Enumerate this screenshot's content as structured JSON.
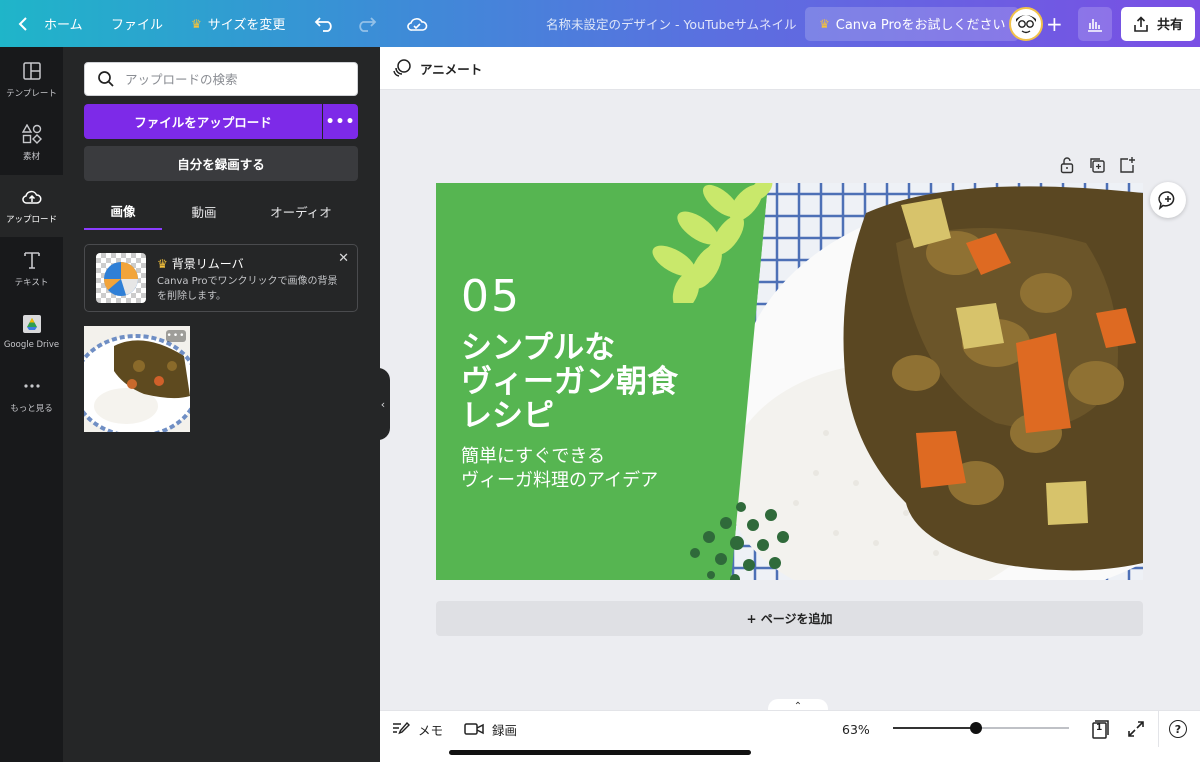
{
  "topbar": {
    "home_label": "ホーム",
    "file_label": "ファイル",
    "resize_label": "サイズを変更",
    "doc_title": "名称未設定のデザイン - YouTubeサムネイル",
    "pro_label": "Canva Proをお試しください",
    "share_label": "共有"
  },
  "rail": {
    "items": [
      {
        "label": "テンプレート",
        "icon": "layout-icon"
      },
      {
        "label": "素材",
        "icon": "shapes-icon"
      },
      {
        "label": "アップロード",
        "icon": "cloud-upload-icon"
      },
      {
        "label": "テキスト",
        "icon": "text-icon"
      },
      {
        "label": "Google Drive",
        "icon": "google-drive-icon"
      },
      {
        "label": "もっと見る",
        "icon": "more-icon"
      }
    ]
  },
  "panel": {
    "search_placeholder": "アップロードの検索",
    "upload_button": "ファイルをアップロード",
    "more_label": "•••",
    "record_button": "自分を録画する",
    "tabs": [
      "画像",
      "動画",
      "オーディオ"
    ],
    "promo": {
      "title": "背景リムーバ",
      "desc": "Canva Proでワンクリックで画像の背景を削除します。",
      "close": "✕"
    },
    "thumb_dots": "•••"
  },
  "canvas": {
    "animate_label": "アニメート",
    "design": {
      "number": "05",
      "headline": "シンプルな\nヴィーガン朝食\nレシピ",
      "subtitle": "簡単にすぐできる\nヴィーガ料理のアイデア"
    },
    "add_page_label": "+ ページを追加"
  },
  "bottombar": {
    "memo_label": "メモ",
    "record_label": "録画",
    "zoom": "63%",
    "page_count": "1",
    "help": "?"
  },
  "colors": {
    "accent": "#7d2ae8",
    "design_green": "#56b551",
    "leaf_light": "#c9e86b",
    "leaf_dark": "#2f6a3a"
  }
}
